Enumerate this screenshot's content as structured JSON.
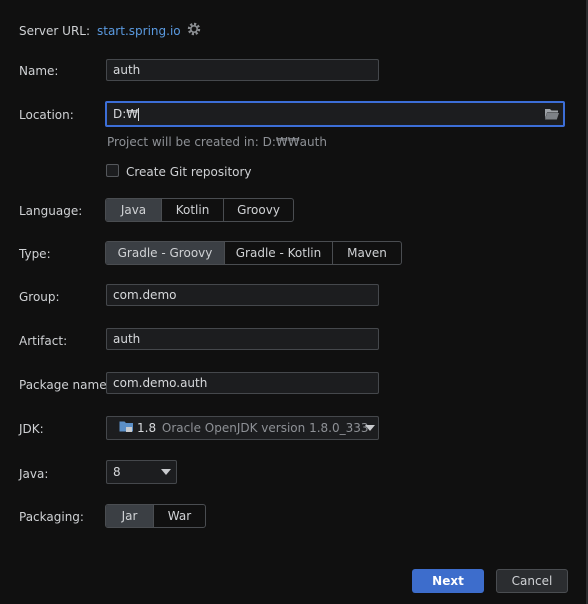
{
  "server": {
    "label": "Server URL:",
    "url": "start.spring.io",
    "settings_icon": "gear-icon"
  },
  "name": {
    "label": "Name:",
    "value": "auth"
  },
  "location": {
    "label": "Location:",
    "value": "D:₩",
    "hint": "Project will be created in: D:₩₩auth",
    "browse_icon": "folder-icon"
  },
  "git": {
    "label": "Create Git repository",
    "checked": false
  },
  "language": {
    "label": "Language:",
    "options": [
      "Java",
      "Kotlin",
      "Groovy"
    ],
    "selected": "Java"
  },
  "type": {
    "label": "Type:",
    "options": [
      "Gradle - Groovy",
      "Gradle - Kotlin",
      "Maven"
    ],
    "selected": "Gradle - Groovy"
  },
  "group": {
    "label": "Group:",
    "value": "com.demo"
  },
  "artifact": {
    "label": "Artifact:",
    "value": "auth"
  },
  "package": {
    "label": "Package name:",
    "value": "com.demo.auth"
  },
  "jdk": {
    "label": "JDK:",
    "version": "1.8",
    "detail": "Oracle OpenJDK version 1.8.0_333"
  },
  "java": {
    "label": "Java:",
    "value": "8"
  },
  "packaging": {
    "label": "Packaging:",
    "options": [
      "Jar",
      "War"
    ],
    "selected": "Jar"
  },
  "buttons": {
    "next": "Next",
    "cancel": "Cancel"
  },
  "colors": {
    "accent": "#3c6ed7",
    "primary_button": "#3d6dcc",
    "link": "#5a9ae0"
  }
}
